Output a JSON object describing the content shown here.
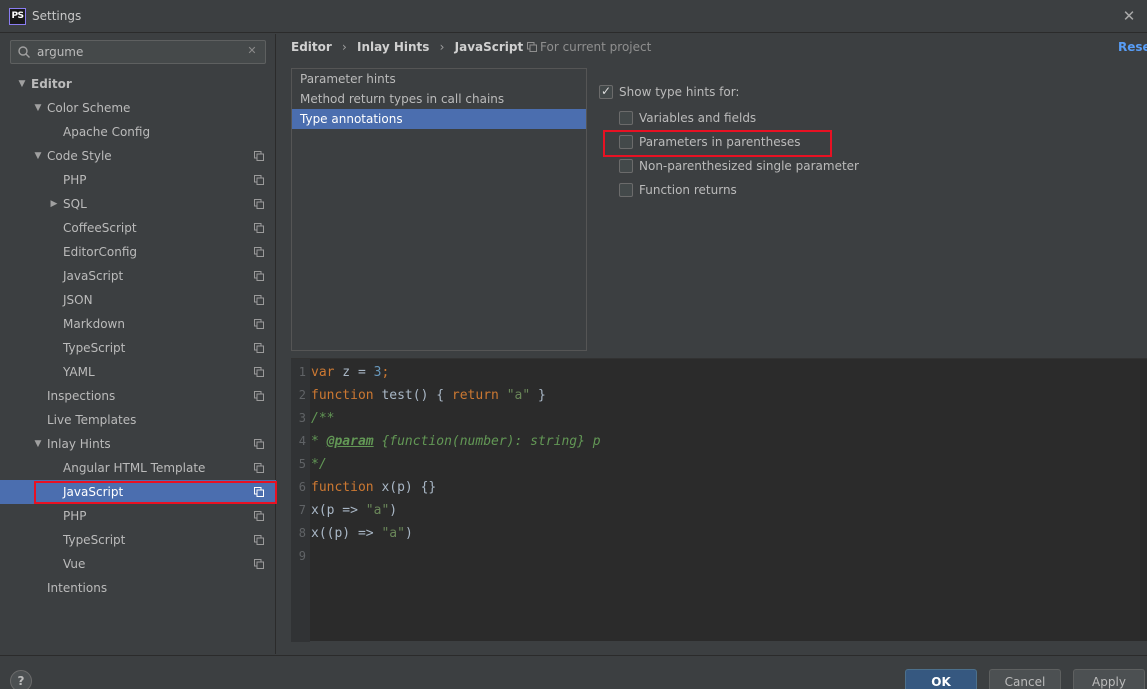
{
  "window": {
    "title": "Settings",
    "logo_text": "PS"
  },
  "search": {
    "value": "argume"
  },
  "tree": [
    {
      "label": "Editor",
      "level": 0,
      "expandable": true,
      "expanded": true,
      "copy": false
    },
    {
      "label": "Color Scheme",
      "level": 1,
      "expandable": true,
      "expanded": true,
      "copy": false
    },
    {
      "label": "Apache Config",
      "level": 2,
      "expandable": false,
      "copy": false
    },
    {
      "label": "Code Style",
      "level": 1,
      "expandable": true,
      "expanded": true,
      "copy": true
    },
    {
      "label": "PHP",
      "level": 2,
      "expandable": false,
      "copy": true
    },
    {
      "label": "SQL",
      "level": 2,
      "expandable": true,
      "expanded": false,
      "copy": true
    },
    {
      "label": "CoffeeScript",
      "level": 2,
      "expandable": false,
      "copy": true
    },
    {
      "label": "EditorConfig",
      "level": 2,
      "expandable": false,
      "copy": true
    },
    {
      "label": "JavaScript",
      "level": 2,
      "expandable": false,
      "copy": true
    },
    {
      "label": "JSON",
      "level": 2,
      "expandable": false,
      "copy": true
    },
    {
      "label": "Markdown",
      "level": 2,
      "expandable": false,
      "copy": true
    },
    {
      "label": "TypeScript",
      "level": 2,
      "expandable": false,
      "copy": true
    },
    {
      "label": "YAML",
      "level": 2,
      "expandable": false,
      "copy": true
    },
    {
      "label": "Inspections",
      "level": 1,
      "expandable": false,
      "copy": true
    },
    {
      "label": "Live Templates",
      "level": 1,
      "expandable": false,
      "copy": false
    },
    {
      "label": "Inlay Hints",
      "level": 1,
      "expandable": true,
      "expanded": true,
      "copy": true
    },
    {
      "label": "Angular HTML Template",
      "level": 2,
      "expandable": false,
      "copy": true
    },
    {
      "label": "JavaScript",
      "level": 2,
      "expandable": false,
      "copy": true,
      "selected": true
    },
    {
      "label": "PHP",
      "level": 2,
      "expandable": false,
      "copy": true
    },
    {
      "label": "TypeScript",
      "level": 2,
      "expandable": false,
      "copy": true
    },
    {
      "label": "Vue",
      "level": 2,
      "expandable": false,
      "copy": true
    },
    {
      "label": "Intentions",
      "level": 1,
      "expandable": false,
      "copy": false
    }
  ],
  "breadcrumb": {
    "part1": "Editor",
    "part2": "Inlay Hints",
    "part3": "JavaScript",
    "separator": "›"
  },
  "scope_label": "For current project",
  "reset_label": "Reset",
  "hint_list": [
    {
      "label": "Parameter hints",
      "selected": false
    },
    {
      "label": "Method return types in call chains",
      "selected": false
    },
    {
      "label": "Type annotations",
      "selected": true
    }
  ],
  "options": {
    "show_type_hints": {
      "label": "Show type hints for:",
      "checked": true
    },
    "variables": {
      "label": "Variables and fields",
      "checked": false
    },
    "params_parens": {
      "label": "Parameters in parentheses",
      "checked": false
    },
    "non_parens": {
      "label": "Non-parenthesized single parameter",
      "checked": false
    },
    "function_returns": {
      "label": "Function returns",
      "checked": false
    }
  },
  "code_lines": [
    [
      {
        "t": "var",
        "c": "kw"
      },
      {
        "t": " z = "
      },
      {
        "t": "3",
        "c": "num"
      },
      {
        "t": ";",
        "c": "kw"
      }
    ],
    [
      {
        "t": "function",
        "c": "kw"
      },
      {
        "t": " test() { "
      },
      {
        "t": "return",
        "c": "kw"
      },
      {
        "t": " "
      },
      {
        "t": "\"a\"",
        "c": "str"
      },
      {
        "t": " }"
      }
    ],
    [
      {
        "t": "/**",
        "c": "cm"
      }
    ],
    [
      {
        "t": "* ",
        "c": "cm"
      },
      {
        "t": "@param",
        "c": "tag"
      },
      {
        "t": " {function(number): string} p",
        "c": "cm"
      }
    ],
    [
      {
        "t": "*/",
        "c": "cm"
      }
    ],
    [
      {
        "t": "function",
        "c": "kw"
      },
      {
        "t": " x(p) {}"
      }
    ],
    [
      {
        "t": "x(p => "
      },
      {
        "t": "\"a\"",
        "c": "str"
      },
      {
        "t": ")"
      }
    ],
    [
      {
        "t": "x((p) => "
      },
      {
        "t": "\"a\"",
        "c": "str"
      },
      {
        "t": ")"
      }
    ],
    []
  ],
  "footer": {
    "help_label": "?",
    "ok_label": "OK",
    "cancel_label": "Cancel",
    "apply_label": "Apply"
  },
  "colors": {
    "selection": "#4b6eaf",
    "highlight": "#e81123",
    "link": "#589df6"
  }
}
